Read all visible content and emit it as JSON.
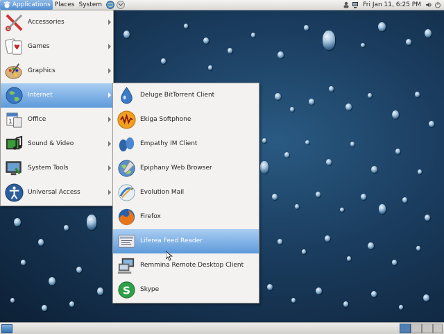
{
  "top_panel": {
    "applications": "Applications",
    "places": "Places",
    "system": "System",
    "clock": "Fri Jan 11,  6:25 PM"
  },
  "main_menu": {
    "items": [
      {
        "label": "Accessories",
        "icon": "accessories-icon"
      },
      {
        "label": "Games",
        "icon": "games-icon"
      },
      {
        "label": "Graphics",
        "icon": "graphics-icon"
      },
      {
        "label": "Internet",
        "icon": "internet-icon",
        "selected": true
      },
      {
        "label": "Office",
        "icon": "office-icon"
      },
      {
        "label": "Sound & Video",
        "icon": "sound-video-icon"
      },
      {
        "label": "System Tools",
        "icon": "system-tools-icon"
      },
      {
        "label": "Universal Access",
        "icon": "universal-access-icon"
      }
    ]
  },
  "internet_menu": {
    "items": [
      {
        "label": "Deluge BitTorrent Client",
        "icon": "deluge-icon"
      },
      {
        "label": "Ekiga Softphone",
        "icon": "ekiga-icon"
      },
      {
        "label": "Empathy IM Client",
        "icon": "empathy-icon"
      },
      {
        "label": "Epiphany Web Browser",
        "icon": "epiphany-icon"
      },
      {
        "label": "Evolution Mail",
        "icon": "evolution-icon"
      },
      {
        "label": "Firefox",
        "icon": "firefox-icon"
      },
      {
        "label": "Liferea Feed Reader",
        "icon": "liferea-icon",
        "selected": true
      },
      {
        "label": "Remmina Remote Desktop Client",
        "icon": "remmina-icon"
      },
      {
        "label": "Skype",
        "icon": "skype-icon"
      }
    ]
  },
  "colors": {
    "selection": "#5d9ada",
    "desktop": "#1a3c5e",
    "panel": "#dcdad6"
  }
}
